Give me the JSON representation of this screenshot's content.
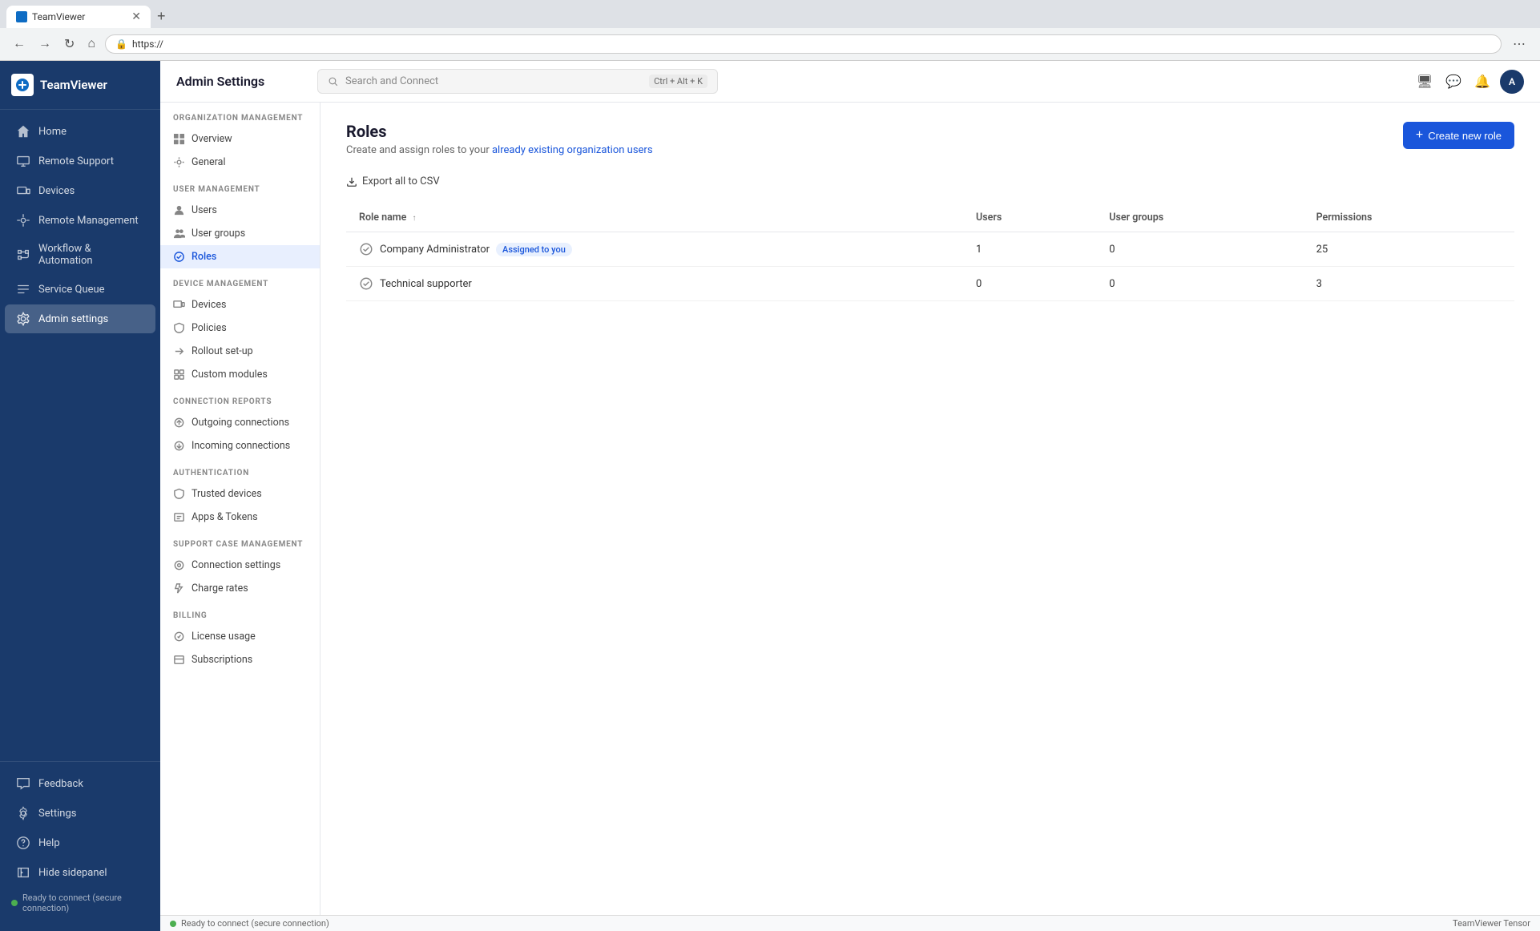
{
  "browser": {
    "tab_title": "TeamViewer",
    "address": "https://",
    "new_tab_label": "+",
    "nav_back": "←",
    "nav_forward": "→",
    "nav_refresh": "↻",
    "nav_home": "⌂"
  },
  "header": {
    "page_title": "Admin Settings",
    "search_placeholder": "Search and Connect",
    "search_shortcut": "Ctrl + Alt + K"
  },
  "sidebar": {
    "logo_text": "TeamViewer",
    "nav_items": [
      {
        "id": "home",
        "label": "Home",
        "icon": "home"
      },
      {
        "id": "remote-support",
        "label": "Remote Support",
        "icon": "remote"
      },
      {
        "id": "devices",
        "label": "Devices",
        "icon": "devices"
      },
      {
        "id": "remote-management",
        "label": "Remote Management",
        "icon": "management"
      },
      {
        "id": "workflow-automation",
        "label": "Workflow & Automation",
        "icon": "workflow"
      },
      {
        "id": "service-queue",
        "label": "Service Queue",
        "icon": "queue"
      },
      {
        "id": "admin-settings",
        "label": "Admin settings",
        "icon": "settings",
        "active": true
      }
    ],
    "bottom_items": [
      {
        "id": "feedback",
        "label": "Feedback",
        "icon": "feedback"
      },
      {
        "id": "settings",
        "label": "Settings",
        "icon": "gear"
      },
      {
        "id": "help",
        "label": "Help",
        "icon": "help"
      },
      {
        "id": "hide-sidepanel",
        "label": "Hide sidepanel",
        "icon": "hide"
      }
    ],
    "status_text": "Ready to connect (secure connection)"
  },
  "secondary_sidebar": {
    "sections": [
      {
        "label": "Organization Management",
        "items": [
          {
            "id": "overview",
            "label": "Overview",
            "icon": "grid"
          },
          {
            "id": "general",
            "label": "General",
            "icon": "gear-sm"
          }
        ]
      },
      {
        "label": "User Management",
        "items": [
          {
            "id": "users",
            "label": "Users",
            "icon": "user"
          },
          {
            "id": "user-groups",
            "label": "User groups",
            "icon": "users"
          },
          {
            "id": "roles",
            "label": "Roles",
            "icon": "role",
            "active": true
          }
        ]
      },
      {
        "label": "Device Management",
        "items": [
          {
            "id": "devices",
            "label": "Devices",
            "icon": "device"
          },
          {
            "id": "policies",
            "label": "Policies",
            "icon": "policy"
          },
          {
            "id": "rollout-setup",
            "label": "Rollout set-up",
            "icon": "rollout"
          },
          {
            "id": "custom-modules",
            "label": "Custom modules",
            "icon": "module"
          }
        ]
      },
      {
        "label": "Connection Reports",
        "items": [
          {
            "id": "outgoing-connections",
            "label": "Outgoing connections",
            "icon": "outgoing"
          },
          {
            "id": "incoming-connections",
            "label": "Incoming connections",
            "icon": "incoming"
          }
        ]
      },
      {
        "label": "Authentication",
        "items": [
          {
            "id": "trusted-devices",
            "label": "Trusted devices",
            "icon": "shield"
          },
          {
            "id": "apps-tokens",
            "label": "Apps & Tokens",
            "icon": "token"
          }
        ]
      },
      {
        "label": "Support Case Management",
        "items": [
          {
            "id": "connection-settings",
            "label": "Connection settings",
            "icon": "conn-settings"
          },
          {
            "id": "charge-rates",
            "label": "Charge rates",
            "icon": "charge"
          }
        ]
      },
      {
        "label": "Billing",
        "items": [
          {
            "id": "license-usage",
            "label": "License usage",
            "icon": "license"
          },
          {
            "id": "subscriptions",
            "label": "Subscriptions",
            "icon": "subscription"
          }
        ]
      }
    ]
  },
  "main": {
    "title": "Roles",
    "subtitle_text": "Create and assign roles to your ",
    "subtitle_link": "already existing organization users",
    "export_label": "Export all to CSV",
    "create_btn_label": "Create new role",
    "table": {
      "columns": [
        {
          "id": "role-name",
          "label": "Role name",
          "sortable": true
        },
        {
          "id": "users",
          "label": "Users"
        },
        {
          "id": "user-groups",
          "label": "User groups"
        },
        {
          "id": "permissions",
          "label": "Permissions"
        }
      ],
      "rows": [
        {
          "id": "company-admin",
          "name": "Company Administrator",
          "badge": "Assigned to you",
          "users": "1",
          "user_groups": "0",
          "permissions": "25"
        },
        {
          "id": "technical-supporter",
          "name": "Technical supporter",
          "badge": "",
          "users": "0",
          "user_groups": "0",
          "permissions": "3"
        }
      ]
    }
  },
  "statusbar": {
    "status_text": "Ready to connect (secure connection)",
    "version_text": "TeamViewer Tensor"
  }
}
